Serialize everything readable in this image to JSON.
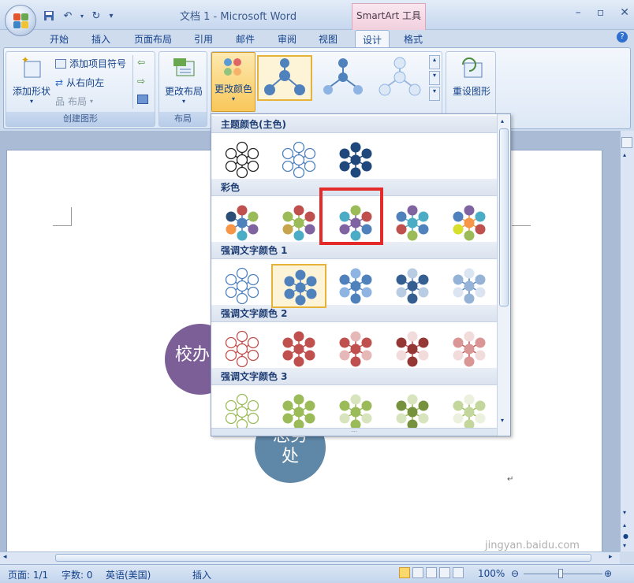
{
  "window": {
    "title": "文档 1 - Microsoft Word",
    "contextual_tab_group": "SmartArt 工具",
    "controls": [
      "–",
      "▫",
      "✕"
    ]
  },
  "tabs": [
    {
      "label": "开始"
    },
    {
      "label": "插入"
    },
    {
      "label": "页面布局"
    },
    {
      "label": "引用"
    },
    {
      "label": "邮件"
    },
    {
      "label": "审阅"
    },
    {
      "label": "视图"
    },
    {
      "label": "设计",
      "active": true
    },
    {
      "label": "格式"
    }
  ],
  "ribbon": {
    "create_graphic": {
      "add_shape": "添加形状",
      "add_bullet": "添加项目符号",
      "right_to_left": "从右向左",
      "layout": "布局",
      "label": "创建图形"
    },
    "layouts": {
      "change_layout": "更改布局",
      "label": "布局"
    },
    "styles": {
      "change_colors": "更改颜色"
    },
    "reset": {
      "reset_graphic": "重设图形"
    }
  },
  "gallery": {
    "sections": [
      {
        "title": "主题颜色(主色)"
      },
      {
        "title": "彩色"
      },
      {
        "title": "强调文字颜色 1"
      },
      {
        "title": "强调文字颜色 2"
      },
      {
        "title": "强调文字颜色 3"
      }
    ]
  },
  "document": {
    "shape_left_text": "校办",
    "shape_bottom_text_line1": "总务",
    "shape_bottom_text_line2": "处",
    "paragraph_mark": "↵"
  },
  "statusbar": {
    "page": "页面: 1/1",
    "words": "字数: 0",
    "language": "英语(美国)",
    "mode": "插入",
    "zoom": "100%"
  },
  "watermark": "jingyan.baidu.com",
  "colors": {
    "purple_shape": "#7c5f97",
    "blue_shape": "#5f87a7",
    "highlight": "#e52a2a"
  }
}
